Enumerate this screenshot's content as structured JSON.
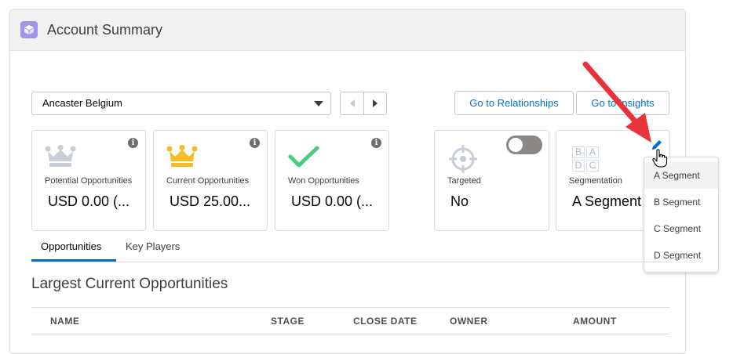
{
  "header": {
    "title": "Account Summary",
    "icon": "cube-icon",
    "icon_color": "#a094ed"
  },
  "toolbar": {
    "account_value": "Ancaster Belgium",
    "go_relationships": "Go to Relationships",
    "go_insights": "Go to Insights"
  },
  "tiles": [
    {
      "label": "Potential Opportunities",
      "value": "USD 0.00 (...",
      "icon": "crown-icon",
      "icon_color": "#c9cdd8"
    },
    {
      "label": "Current Opportunities",
      "value": "USD 25.00...",
      "icon": "crown-icon",
      "icon_color": "#f4bc25"
    },
    {
      "label": "Won Opportunities",
      "value": "USD 0.00 (...",
      "icon": "checkmark-icon",
      "icon_color": "#4bca81"
    }
  ],
  "targeted": {
    "label": "Targeted",
    "value": "No",
    "icon": "target-icon",
    "toggle_on": false
  },
  "segmentation": {
    "label": "Segmentation",
    "value": "A Segment",
    "icon": "segment-grid-icon",
    "grid": [
      "B",
      "A",
      "D",
      "C"
    ]
  },
  "dropdown": {
    "options": [
      "A Segment",
      "B Segment",
      "C Segment",
      "D Segment"
    ],
    "highlighted": "A Segment"
  },
  "tabs": [
    {
      "label": "Opportunities",
      "active": true
    },
    {
      "label": "Key Players",
      "active": false
    }
  ],
  "section": {
    "title": "Largest Current Opportunities"
  },
  "table": {
    "columns": [
      "NAME",
      "STAGE",
      "CLOSE DATE",
      "OWNER",
      "AMOUNT"
    ]
  },
  "colors": {
    "accent": "#0070d2",
    "annotation_arrow": "#e8333a"
  }
}
